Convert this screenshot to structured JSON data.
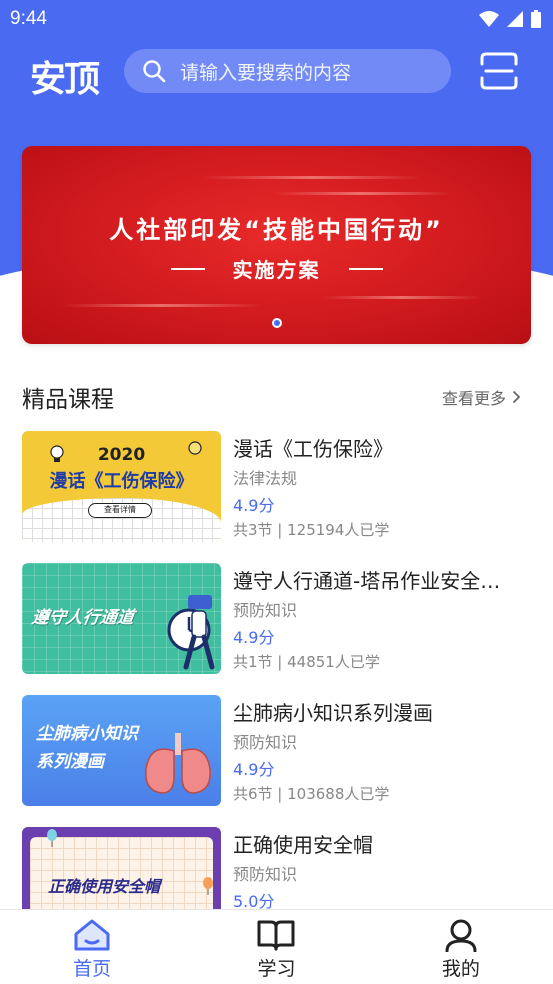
{
  "status_bar": {
    "time": "9:44"
  },
  "header": {
    "logo": "安顶",
    "search_placeholder": "请输入要搜索的内容"
  },
  "banner": {
    "title": "人社部印发“技能中国行动”",
    "subtitle": "实施方案",
    "active_dot": 1,
    "dot_count": 1
  },
  "section": {
    "title": "精品课程",
    "more": "查看更多"
  },
  "courses": [
    {
      "title": "漫话《工伤保险》",
      "category": "法律法规",
      "score": "4.9分",
      "meta": "共3节 | 125194人已学",
      "thumb": {
        "year": "2020",
        "name": "漫话《工伤保险》",
        "button": "查看详情"
      }
    },
    {
      "title": "遵守人行通道-塔吊作业安全…",
      "category": "预防知识",
      "score": "4.9分",
      "meta": "共1节 | 44851人已学",
      "thumb": {
        "label": "遵守人行通道"
      }
    },
    {
      "title": "尘肺病小知识系列漫画",
      "category": "预防知识",
      "score": "4.9分",
      "meta": "共6节 | 103688人已学",
      "thumb": {
        "line1": "尘肺病小知识",
        "line2": "系列漫画"
      }
    },
    {
      "title": "正确使用安全帽",
      "category": "预防知识",
      "score": "5.0分",
      "meta": "",
      "thumb": {
        "label": "正确使用安全帽"
      }
    }
  ],
  "nav": {
    "items": [
      {
        "label": "首页",
        "icon": "home-icon",
        "active": true
      },
      {
        "label": "学习",
        "icon": "book-icon",
        "active": false
      },
      {
        "label": "我的",
        "icon": "user-icon",
        "active": false
      }
    ]
  },
  "colors": {
    "primary": "#4a6af2",
    "banner_red": "#d01a1e",
    "text": "#222222",
    "muted": "#888888"
  }
}
